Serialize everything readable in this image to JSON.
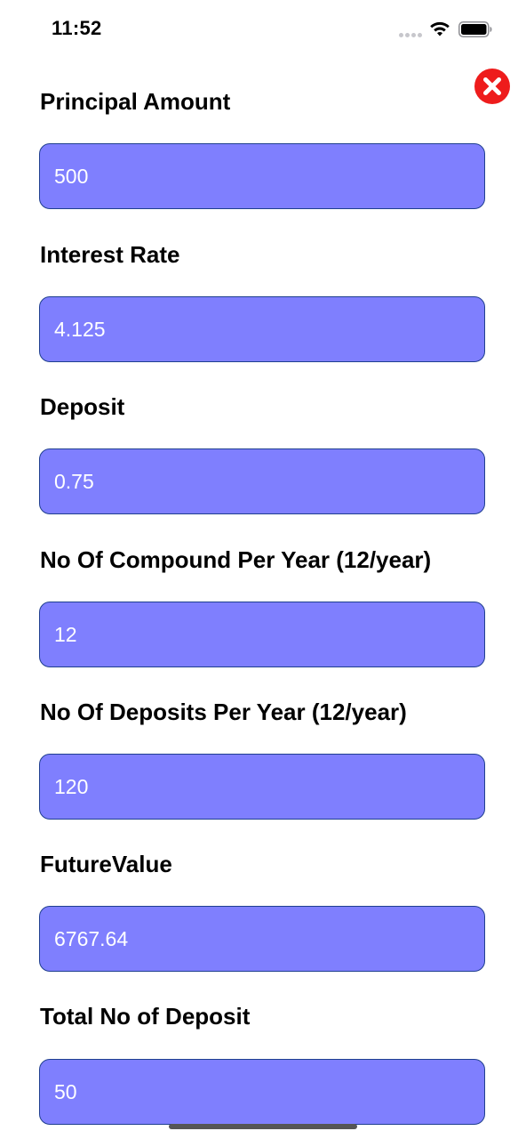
{
  "status_bar": {
    "time": "11:52"
  },
  "close_button": {
    "icon": "close-circle-icon",
    "color": "#ee1c1c"
  },
  "form": {
    "principal_label": "Principal Amount",
    "principal_value": "500",
    "interest_label": "Interest Rate",
    "interest_value": "4.125",
    "deposit_label": "Deposit",
    "deposit_value": "0.75",
    "compound_label": "No Of Compound Per Year (12/year)",
    "compound_value": "12",
    "deposits_per_year_label": "No Of Deposits Per Year (12/year)",
    "deposits_per_year_value": "120",
    "future_value_label": "FutureValue",
    "future_value_value": "6767.64",
    "total_deposit_label": "Total No of Deposit",
    "total_deposit_value": "50"
  },
  "colors": {
    "input_background": "#7f7ffe",
    "input_border": "#1f3f8f"
  }
}
